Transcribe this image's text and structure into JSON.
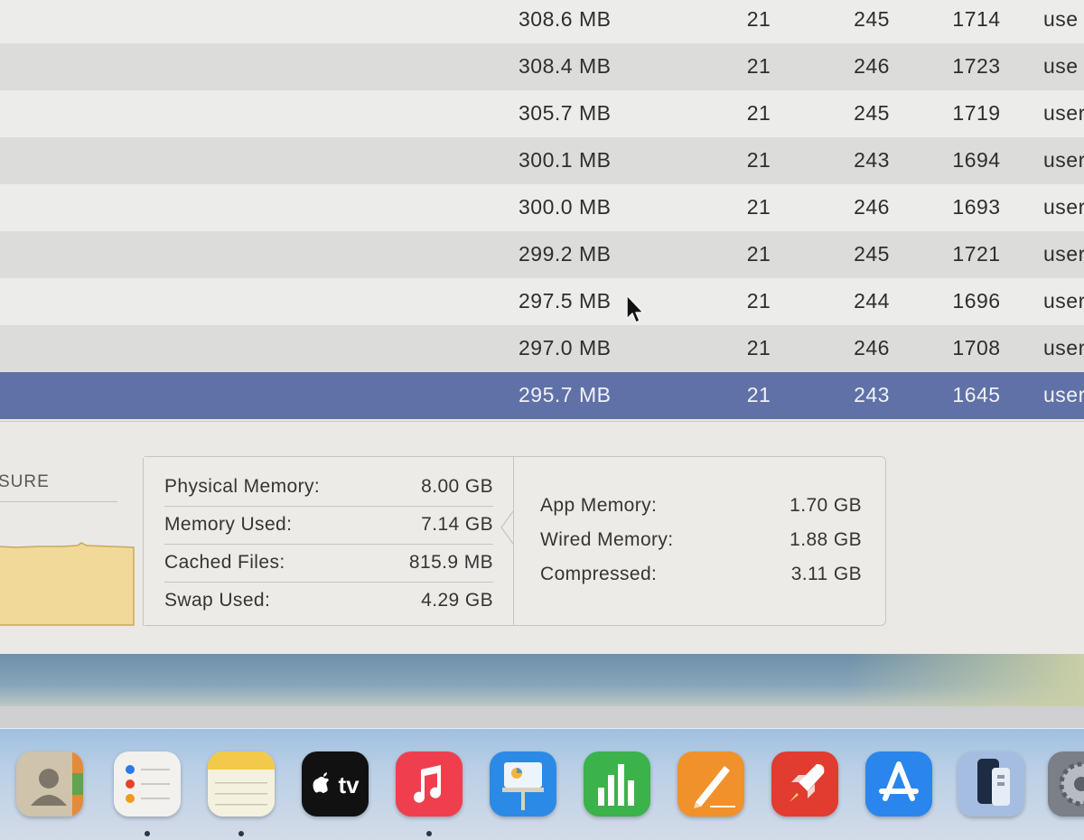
{
  "process_rows": [
    {
      "memory": "308.6 MB",
      "threads": "21",
      "ports": "245",
      "pid": "1714",
      "user": "use"
    },
    {
      "memory": "308.4 MB",
      "threads": "21",
      "ports": "246",
      "pid": "1723",
      "user": "use"
    },
    {
      "memory": "305.7 MB",
      "threads": "21",
      "ports": "245",
      "pid": "1719",
      "user": "user"
    },
    {
      "memory": "300.1 MB",
      "threads": "21",
      "ports": "243",
      "pid": "1694",
      "user": "user"
    },
    {
      "memory": "300.0 MB",
      "threads": "21",
      "ports": "246",
      "pid": "1693",
      "user": "user"
    },
    {
      "memory": "299.2 MB",
      "threads": "21",
      "ports": "245",
      "pid": "1721",
      "user": "user"
    },
    {
      "memory": "297.5 MB",
      "threads": "21",
      "ports": "244",
      "pid": "1696",
      "user": "user"
    },
    {
      "memory": "297.0 MB",
      "threads": "21",
      "ports": "246",
      "pid": "1708",
      "user": "user"
    },
    {
      "memory": "295.7 MB",
      "threads": "21",
      "ports": "243",
      "pid": "1645",
      "user": "user",
      "selected": true
    }
  ],
  "pressure": {
    "title": "SURE",
    "fill_color": "#f1d99a",
    "edge_color": "#c9a85a"
  },
  "memory_stats": {
    "physical_memory": {
      "label": "Physical Memory:",
      "value": "8.00 GB"
    },
    "memory_used": {
      "label": "Memory Used:",
      "value": "7.14 GB"
    },
    "cached_files": {
      "label": "Cached Files:",
      "value": "815.9 MB"
    },
    "swap_used": {
      "label": "Swap Used:",
      "value": "4.29 GB"
    }
  },
  "memory_breakdown": {
    "app_memory": {
      "label": "App Memory:",
      "value": "1.70 GB"
    },
    "wired_memory": {
      "label": "Wired Memory:",
      "value": "1.88 GB"
    },
    "compressed": {
      "label": "Compressed:",
      "value": "3.11 GB"
    }
  },
  "colors": {
    "selected_row": "#5f71a7",
    "row_light": "#ececea",
    "row_dark": "#dcdcda"
  },
  "dock": {
    "apps": [
      {
        "name": "contacts-icon",
        "running": false
      },
      {
        "name": "reminders-icon",
        "running": true
      },
      {
        "name": "notes-icon",
        "running": true
      },
      {
        "name": "apple-tv-icon",
        "running": false,
        "label": "tv"
      },
      {
        "name": "music-icon",
        "running": true
      },
      {
        "name": "keynote-icon",
        "running": false
      },
      {
        "name": "numbers-icon",
        "running": false
      },
      {
        "name": "pages-icon",
        "running": false
      },
      {
        "name": "rocketsim-icon",
        "running": false
      },
      {
        "name": "app-store-icon",
        "running": false
      },
      {
        "name": "simulator-icon",
        "running": false
      },
      {
        "name": "system-settings-icon",
        "running": false
      }
    ]
  }
}
